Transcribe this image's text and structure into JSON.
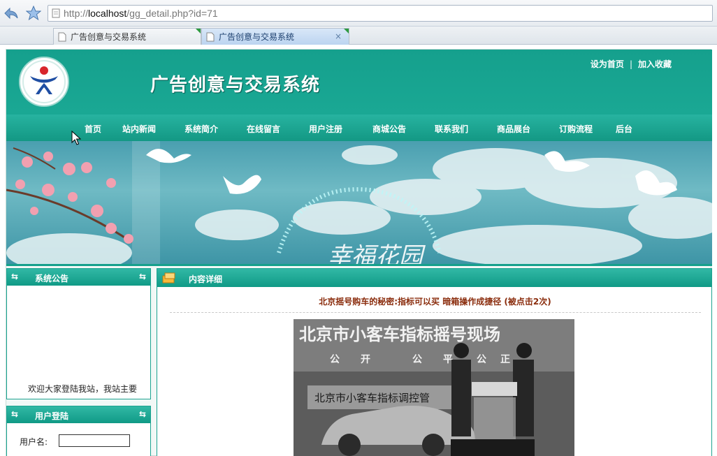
{
  "browser": {
    "url_prefix": "http://",
    "url_host": "localhost",
    "url_path": "/gg_detail.php?id=71",
    "tabs": [
      {
        "title": "广告创意与交易系统"
      },
      {
        "title": "广告创意与交易系统",
        "active": true,
        "close": "×"
      }
    ]
  },
  "header": {
    "site_title": "广告创意与交易系统",
    "set_home": "设为首页",
    "separator": "|",
    "add_favorite": "加入收藏"
  },
  "nav": [
    "首页",
    "站内新闻",
    "系统简介",
    "在线留言",
    "用户注册",
    "商城公告",
    "联系我们",
    "商品展台",
    "订购流程",
    "后台"
  ],
  "banner": {
    "text": "幸福花园"
  },
  "sidebar": {
    "notice_title": "系统公告",
    "notice_marquee": "欢迎大家登陆我站，我站主要",
    "login_title": "用户登陆",
    "username_label": "用户名:"
  },
  "content": {
    "section_title": "内容详细",
    "article_title": "北京摇号购车的秘密:指标可以买 暗箱操作成捷径 (被点击2次)",
    "image_headline": "北京市小客车指标摇号现场",
    "image_subline": [
      "公",
      "开",
      "公",
      "平",
      "公",
      "正"
    ],
    "image_sign": "北京市小客车指标调控管"
  },
  "colors": {
    "primary_teal": "#18a38f",
    "title_red": "#8a2c0c"
  }
}
